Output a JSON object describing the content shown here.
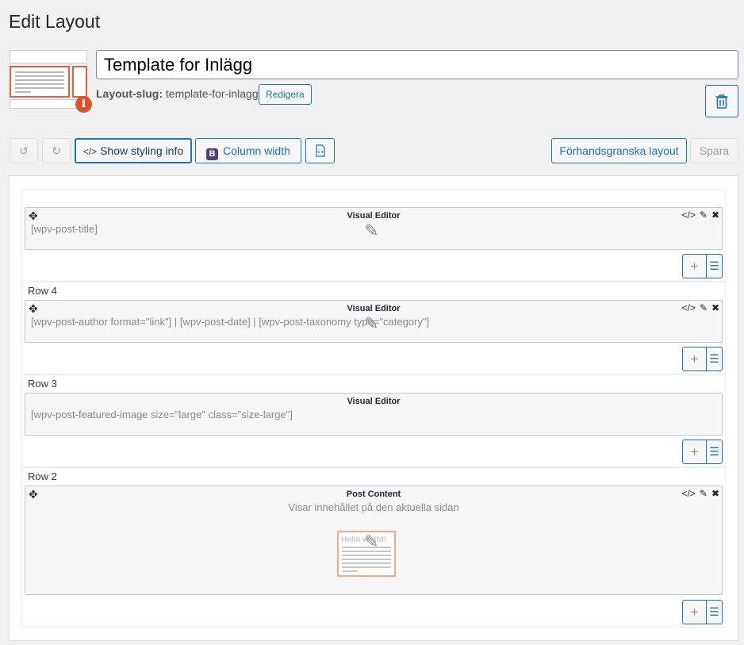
{
  "header": {
    "title": "Edit Layout"
  },
  "layout": {
    "title_value": "Template for Inlägg",
    "slug_label": "Layout-slug:",
    "slug_value": "template-for-inlagg",
    "edit_slug_label": "Redigera"
  },
  "toolbar": {
    "styling_label": "Show styling info",
    "column_width_label": "Column width",
    "column_width_icon_letter": "B",
    "preview_label": "Förhandsgranska layout",
    "save_label": "Spara"
  },
  "rows": [
    {
      "label": "",
      "cell_type": "Visual Editor",
      "content": "[wpv-post-title]"
    },
    {
      "label": "Row 4",
      "cell_type": "Visual Editor",
      "content": "[wpv-post-author format=\"link\"] | [wpv-post-date] | [wpv-post-taxonomy type=\"category\"]"
    },
    {
      "label": "Row 3",
      "cell_type": "Visual Editor",
      "content": "[wpv-post-featured-image size=\"large\" class=\"size-large\"]"
    },
    {
      "label": "Row 2",
      "cell_type": "Post Content",
      "content": "Visar innehållet på den aktuella sidan",
      "preview_title": "Hello world!"
    }
  ],
  "colors": {
    "accent": "#2271b1",
    "info": "#d9532c",
    "bootstrap": "#563d7c"
  }
}
